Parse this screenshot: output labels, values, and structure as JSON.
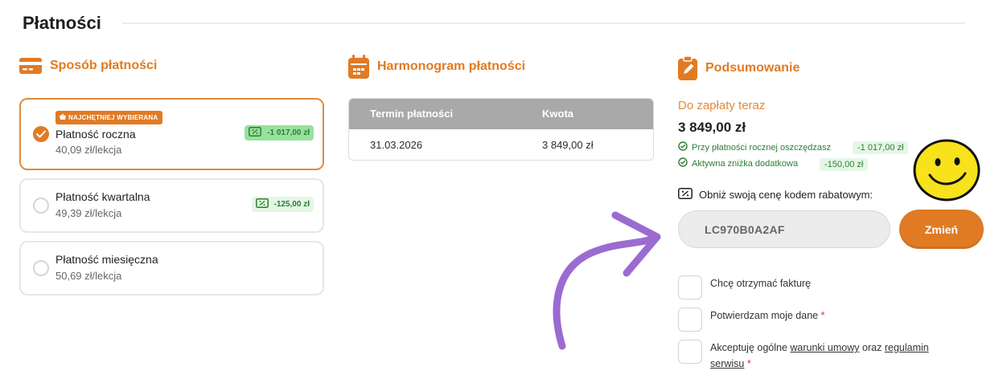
{
  "page": {
    "title": "Płatności"
  },
  "payment_method": {
    "heading": "Sposób płatności",
    "options": [
      {
        "badge": "NAJCHĘTNIEJ WYBIERANA",
        "name": "Płatność roczna",
        "price": "40,09 zł/lekcja",
        "saving": "-1 017,00 zł",
        "selected": true
      },
      {
        "name": "Płatność kwartalna",
        "price": "49,39 zł/lekcja",
        "saving": "-125,00 zł",
        "selected": false
      },
      {
        "name": "Płatność miesięczna",
        "price": "50,69 zł/lekcja",
        "selected": false
      }
    ]
  },
  "schedule": {
    "heading": "Harmonogram płatności",
    "columns": [
      "Termin płatności",
      "Kwota"
    ],
    "rows": [
      [
        "31.03.2026",
        "3 849,00 zł"
      ]
    ]
  },
  "summary": {
    "heading": "Podsumowanie",
    "due_label": "Do zapłaty teraz",
    "due_amount": "3 849,00 zł",
    "notes": [
      {
        "text": "Przy płatności rocznej oszczędzasz",
        "value": "-1 017,00 zł"
      },
      {
        "text": "Aktywna zniżka dodatkowa",
        "value": "-150,00 zł"
      }
    ],
    "promo": {
      "label": "Obniż swoją cenę kodem rabatowym:",
      "code": "LC970B0A2AF",
      "button": "Zmień"
    },
    "checkboxes": {
      "invoice": "Chcę otrzymać fakturę",
      "confirm": "Potwierdzam moje dane",
      "required_mark": "*",
      "terms_prefix": "Akceptuję ogólne",
      "terms_link": "warunki umowy",
      "terms_and": "oraz",
      "regulations_link_1": "regulamin",
      "regulations_link_2": "serwisu"
    }
  },
  "colors": {
    "accent": "#e07b24",
    "success": "#2e7d32",
    "overlay_arrow": "#9b6bd1",
    "smiley": "#f7e21b"
  }
}
